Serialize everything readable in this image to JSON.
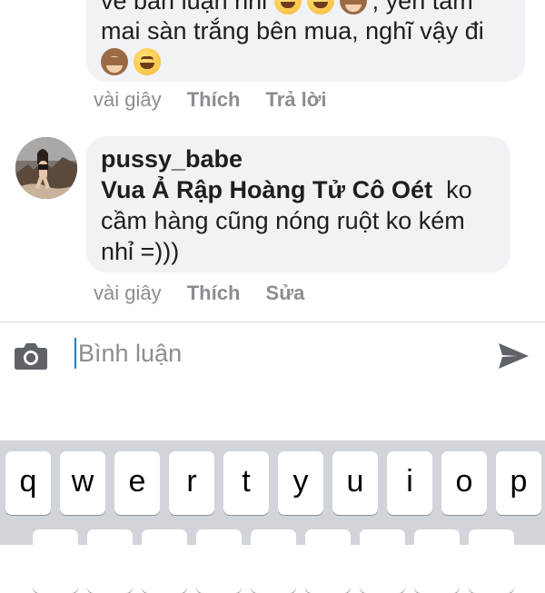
{
  "comments": [
    {
      "lines": [
        "về bàn luận nhỉ",
        ", yên tâm",
        "mai sàn trắng bên mua, nghĩ vậy đi"
      ],
      "emojis_line1": [
        "grin-emoji",
        "grin-emoji",
        "monkey-emoji"
      ],
      "emojis_line3": [
        "monkey-emoji",
        "grin-emoji"
      ],
      "time": "vài giây",
      "like_label": "Thích",
      "reply_label": "Trả lời"
    },
    {
      "author": "pussy_babe",
      "mention": "Vua Ả Rập Hoàng Tử Cô Oét",
      "text_inline": "ko",
      "lines": [
        "cầm hàng cũng nóng ruột ko kém",
        "nhỉ =)))"
      ],
      "time": "vài giây",
      "like_label": "Thích",
      "edit_label": "Sửa"
    }
  ],
  "composer": {
    "placeholder": "Bình luận",
    "camera_icon": "camera-icon",
    "send_icon": "send-icon"
  },
  "keyboard": {
    "row1": [
      "q",
      "w",
      "e",
      "r",
      "t",
      "y",
      "u",
      "i",
      "o",
      "p"
    ]
  },
  "colors": {
    "bubble": "#f0f2f5",
    "meta_text": "#8a8d91",
    "caret": "#1877f2",
    "keyboard_bg": "#d1d4d9"
  }
}
